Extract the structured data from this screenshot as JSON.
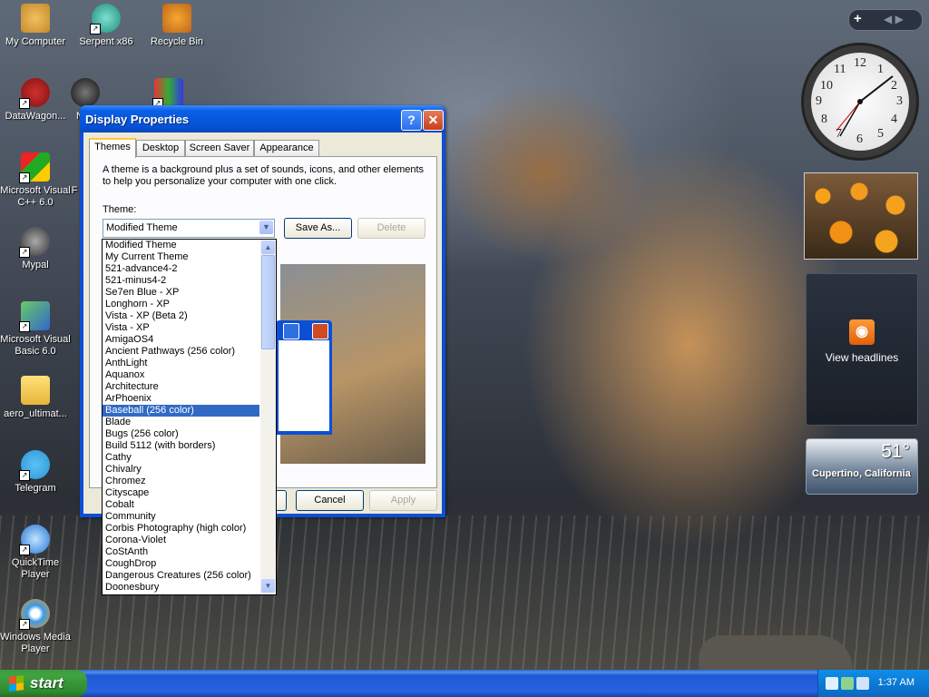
{
  "desktop": {
    "icons": [
      {
        "label": "My Computer"
      },
      {
        "label": "Serpent x86"
      },
      {
        "label": "Recycle Bin"
      },
      {
        "label": "DataWagon..."
      },
      {
        "label": "N"
      },
      {
        "label": "Microsoft Visual C++ 6.0"
      },
      {
        "label": "F"
      },
      {
        "label": "Mypal"
      },
      {
        "label": "Microsoft Visual Basic 6.0"
      },
      {
        "label": "aero_ultimat..."
      },
      {
        "label": "Telegram"
      },
      {
        "label": "QuickTime Player"
      },
      {
        "label": "Windows Media Player"
      }
    ]
  },
  "window": {
    "title": "Display Properties",
    "help_glyph": "?",
    "close_glyph": "✕",
    "tabs": [
      "Themes",
      "Desktop",
      "Screen Saver",
      "Appearance"
    ],
    "description": "A theme is a background plus a set of sounds, icons, and other elements to help you personalize your computer with one click.",
    "theme_label": "Theme:",
    "theme_value": "Modified Theme",
    "save_as_label": "Save As...",
    "delete_label": "Delete",
    "cancel_label": "Cancel",
    "apply_label": "Apply"
  },
  "dropdown": {
    "selected": "Baseball (256 color)",
    "items": [
      "Modified Theme",
      "My Current Theme",
      "521-advance4-2",
      "521-minus4-2",
      "Se7en Blue - XP",
      "Longhorn - XP",
      "Vista - XP (Beta 2)",
      "Vista - XP",
      "AmigaOS4",
      "Ancient Pathways (256 color)",
      "AnthLight",
      "Aquanox",
      "Architecture",
      "ArPhoenix",
      "Baseball (256 color)",
      "Blade",
      "Bugs (256 color)",
      "Build 5112 (with borders)",
      "Cathy",
      "Chivalry",
      "Chromez",
      "Cityscape",
      "Cobalt",
      "Community",
      "Corbis Photography (high color)",
      "Corona-Violet",
      "CoStAnth",
      "CoughDrop",
      "Dangerous Creatures (256 color)",
      "Doonesbury"
    ]
  },
  "sidebar": {
    "add_glyph": "+",
    "nav_glyphs": "◀ ▶",
    "clock_numbers": [
      "12",
      "1",
      "2",
      "3",
      "4",
      "5",
      "6",
      "7",
      "8",
      "9",
      "10",
      "11"
    ],
    "feed_label": "View headlines",
    "weather_temp": "51°",
    "weather_city": "Cupertino, California"
  },
  "taskbar": {
    "start_label": "start",
    "time": "1:37 AM"
  }
}
